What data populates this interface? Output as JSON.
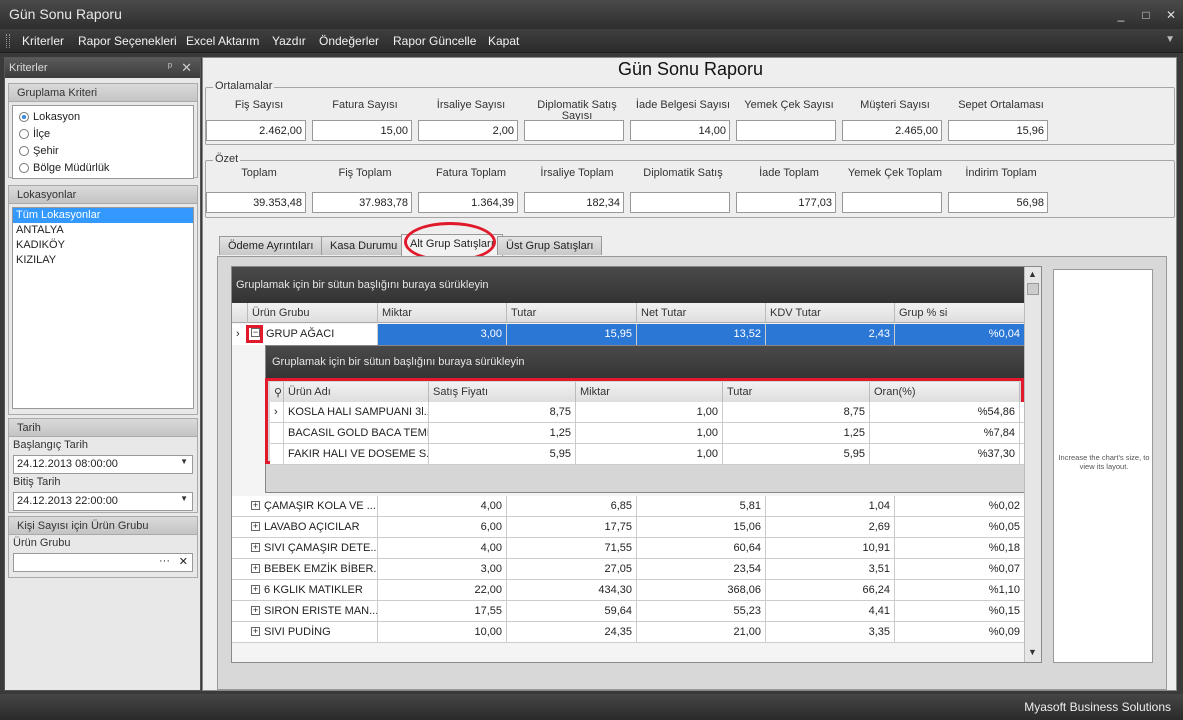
{
  "window": {
    "title": "Gün Sonu Raporu",
    "controls": [
      "_",
      "□",
      "✕"
    ]
  },
  "menu": [
    "Kriterler",
    "Rapor Seçenekleri",
    "Excel Aktarım",
    "Yazdır",
    "Öndeğerler",
    "Rapor Güncelle",
    "Kapat"
  ],
  "sidebar": {
    "title": "Kriterler",
    "grouping": {
      "title": "Gruplama Kriteri",
      "options": [
        "Lokasyon",
        "İlçe",
        "Şehir",
        "Bölge Müdürlük"
      ],
      "selected": "Lokasyon"
    },
    "locations": {
      "title": "Lokasyonlar",
      "items": [
        "Tüm Lokasyonlar",
        "ANTALYA",
        "KADIKÖY",
        "KIZILAY"
      ],
      "selected": "Tüm Lokasyonlar"
    },
    "date": {
      "title": "Tarih",
      "start_label": "Başlangıç Tarih",
      "start_value": "24.12.2013 08:00:00",
      "end_label": "Bitiş Tarih",
      "end_value": "24.12.2013 22:00:00"
    },
    "product": {
      "title": "Kişi Sayısı için Ürün Grubu",
      "label": "Ürün Grubu",
      "value": "",
      "browse": "···",
      "clear": "✕"
    }
  },
  "page_title": "Gün Sonu Raporu",
  "averages": {
    "legend": "Ortalamalar",
    "fields": [
      {
        "label": "Fiş Sayısı",
        "value": "2.462,00"
      },
      {
        "label": "Fatura Sayısı",
        "value": "15,00"
      },
      {
        "label": "İrsaliye Sayısı",
        "value": "2,00"
      },
      {
        "label": "Diplomatik Satış Sayısı",
        "value": ""
      },
      {
        "label": "İade Belgesi Sayısı",
        "value": "14,00"
      },
      {
        "label": "Yemek Çek Sayısı",
        "value": ""
      },
      {
        "label": "Müşteri Sayısı",
        "value": "2.465,00"
      },
      {
        "label": "Sepet Ortalaması",
        "value": "15,96"
      }
    ]
  },
  "summary": {
    "legend": "Özet",
    "fields": [
      {
        "label": "Toplam",
        "value": "39.353,48"
      },
      {
        "label": "Fiş Toplam",
        "value": "37.983,78"
      },
      {
        "label": "Fatura Toplam",
        "value": "1.364,39"
      },
      {
        "label": "İrsaliye Toplam",
        "value": "182,34"
      },
      {
        "label": "Diplomatik Satış",
        "value": ""
      },
      {
        "label": "İade Toplam",
        "value": "177,03"
      },
      {
        "label": "Yemek Çek Toplam",
        "value": ""
      },
      {
        "label": "İndirim Toplam",
        "value": "56,98"
      }
    ]
  },
  "tabs": [
    {
      "label": "Ödeme Ayrıntıları",
      "active": false
    },
    {
      "label": "Kasa Durumu",
      "active": false
    },
    {
      "label": "Alt Grup Satışları",
      "active": true
    },
    {
      "label": "Üst Grup Satışları",
      "active": false
    }
  ],
  "grid": {
    "group_hint": "Gruplamak için bir sütun başlığını buraya sürükleyin",
    "columns": [
      "Ürün Grubu",
      "Miktar",
      "Tutar",
      "Net Tutar",
      "KDV Tutar",
      "Grup % si"
    ],
    "expanded_row": {
      "name": "GRUP AĞACI",
      "miktar": "3,00",
      "tutar": "15,95",
      "net": "13,52",
      "kdv": "2,43",
      "pct": "%0,04"
    },
    "detail": {
      "group_hint": "Gruplamak için bir sütun başlığını buraya sürükleyin",
      "columns": [
        "Ürün Adı",
        "Satış Fiyatı",
        "Miktar",
        "Tutar",
        "Oran(%)"
      ],
      "rows": [
        [
          "KOSLA HALI SAMPUANI 3l...",
          "8,75",
          "1,00",
          "8,75",
          "%54,86"
        ],
        [
          "BACASIL GOLD BACA TEMI...",
          "1,25",
          "1,00",
          "1,25",
          "%7,84"
        ],
        [
          "FAKIR HALI VE DOSEME S...",
          "5,95",
          "1,00",
          "5,95",
          "%37,30"
        ]
      ]
    },
    "rows": [
      [
        "ÇAMAŞIR KOLA VE ...",
        "4,00",
        "6,85",
        "5,81",
        "1,04",
        "%0,02"
      ],
      [
        "LAVABO AÇICILAR",
        "6,00",
        "17,75",
        "15,06",
        "2,69",
        "%0,05"
      ],
      [
        "SIVI ÇAMAŞIR DETE...",
        "4,00",
        "71,55",
        "60,64",
        "10,91",
        "%0,18"
      ],
      [
        "BEBEK EMZİK BİBER...",
        "3,00",
        "27,05",
        "23,54",
        "3,51",
        "%0,07"
      ],
      [
        "6 KGLIK MATIKLER",
        "22,00",
        "434,30",
        "368,06",
        "66,24",
        "%1,10"
      ],
      [
        "SIRON ERISTE MAN...",
        "17,55",
        "59,64",
        "55,23",
        "4,41",
        "%0,15"
      ],
      [
        "SIVI PUDİNG",
        "10,00",
        "24,35",
        "21,00",
        "3,35",
        "%0,09"
      ]
    ]
  },
  "chart_message": "Increase the chart's size, to view its layout.",
  "status": "Myasoft Business Solutions",
  "colors": {
    "accent": "#2a77d6",
    "highlight": "#e01a2a"
  }
}
